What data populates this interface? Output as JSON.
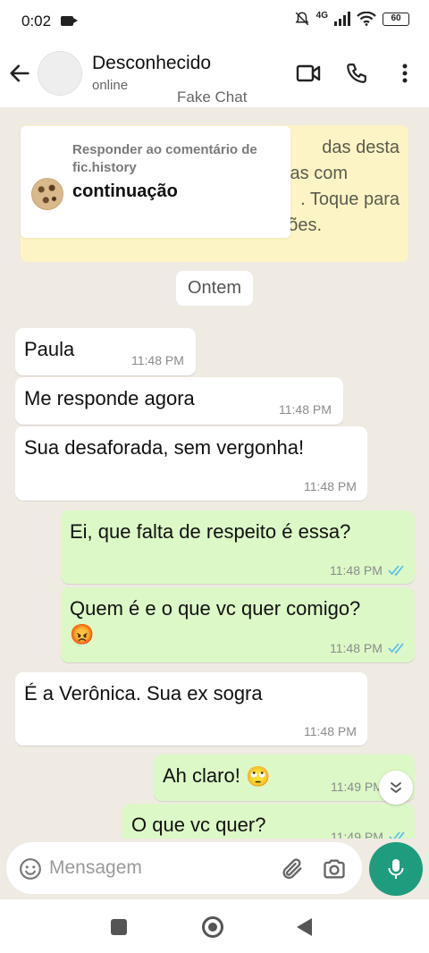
{
  "status_bar": {
    "time": "0:02",
    "network": "4G",
    "battery": "60"
  },
  "header": {
    "contact_name": "Desconhecido",
    "contact_status": "online",
    "overlay_label": "Fake Chat",
    "icons": {
      "back": "arrow-left-icon",
      "video": "video-call-icon",
      "call": "phone-icon",
      "menu": "more-vertical-icon"
    }
  },
  "notice": {
    "line1": "das desta",
    "line2": "uras com",
    "line3": ". Toque para",
    "line4": "obter mais informações."
  },
  "reply_card": {
    "title": "Responder ao comentário de fic.history",
    "text": "continuação"
  },
  "date_chip": "Ontem",
  "messages": [
    {
      "dir": "in",
      "text": "Paula",
      "time": "11:48 PM"
    },
    {
      "dir": "in",
      "text": "Me responde agora",
      "time": "11:48 PM"
    },
    {
      "dir": "in",
      "text": "Sua desaforada, sem vergonha!",
      "time": "11:48 PM"
    },
    {
      "dir": "out",
      "text": "Ei, que falta de respeito é essa?",
      "time": "11:48 PM",
      "read": true
    },
    {
      "dir": "out",
      "text": "Quem é e o que vc quer comigo?",
      "emoji": "😡",
      "time": "11:48 PM",
      "read": true
    },
    {
      "dir": "in",
      "text": "É a Verônica. Sua ex sogra",
      "time": "11:48 PM"
    },
    {
      "dir": "out",
      "text": "Ah claro!",
      "emoji": "🙄",
      "time": "11:49 PM",
      "read": true
    },
    {
      "dir": "out",
      "text": "O que vc quer?",
      "time": "11:49 PM",
      "read": true
    }
  ],
  "input": {
    "placeholder": "Mensagem",
    "value": ""
  },
  "colors": {
    "accent": "#1f9c7d",
    "outgoing_bubble": "#dcf8c6",
    "incoming_bubble": "#ffffff",
    "read_tick": "#53bdeb",
    "chat_bg": "#efeae2",
    "notice_bg": "#fdf4c5"
  }
}
